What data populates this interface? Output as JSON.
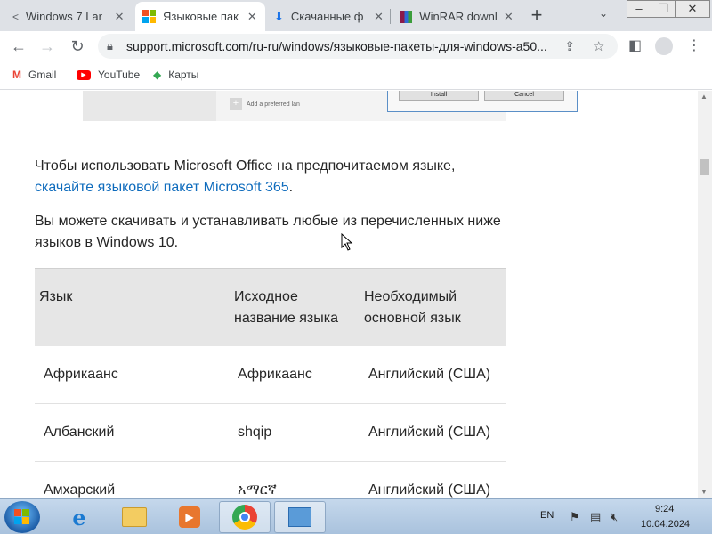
{
  "tabs": [
    {
      "title": "Windows 7 Lar",
      "icon": "share-icon",
      "close": "✕"
    },
    {
      "title": "Языковые пак",
      "icon": "microsoft-logo-icon",
      "close": "✕"
    },
    {
      "title": "Скачанные ф",
      "icon": "download-icon",
      "close": "✕"
    },
    {
      "title": "WinRAR downl",
      "icon": "winrar-icon",
      "close": "✕"
    }
  ],
  "new_tab_label": "+",
  "address": {
    "url": "support.microsoft.com/ru-ru/windows/языковые-пакеты-для-windows-a50..."
  },
  "bookmarks": [
    {
      "label": "Gmail",
      "icon": "gmail-icon"
    },
    {
      "label": "YouTube",
      "icon": "youtube-icon"
    },
    {
      "label": "Карты",
      "icon": "maps-icon"
    }
  ],
  "screenshot_strip": {
    "add_preferred": "Add a preferred lan",
    "install": "Install",
    "cancel": "Cancel"
  },
  "content": {
    "para1_text": "Чтобы использовать Microsoft Office на предпочитаемом языке,",
    "para1_link": "скачайте языковой пакет Microsoft 365",
    "para1_end": ".",
    "para2_text": "Вы можете скачивать и устанавливать любые из перечисленных ниже языков в Windows 10."
  },
  "table": {
    "headers": [
      "Язык",
      "Исходное название языка",
      "Необходимый основной язык"
    ],
    "rows": [
      [
        "Африкаанс",
        "Африкаанс",
        "Английский (США)"
      ],
      [
        "Албанский",
        "shqip",
        "Английский (США)"
      ],
      [
        "Амхарский",
        "አማርኛ",
        "Английский (США)"
      ]
    ]
  },
  "taskbar": {
    "language": "EN",
    "time": "9:24",
    "date": "10.04.2024",
    "apps": [
      "internet-explorer",
      "file-explorer",
      "media-player",
      "chrome",
      "control-panel"
    ]
  }
}
